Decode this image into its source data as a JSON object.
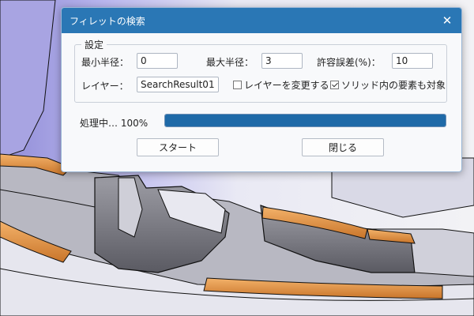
{
  "dialog": {
    "title": "フィレットの検索",
    "close_glyph": "✕",
    "group_label": "設定",
    "min_radius": {
      "label": "最小半径：",
      "value": "0"
    },
    "max_radius": {
      "label": "最大半径：",
      "value": "3"
    },
    "tolerance": {
      "label": "許容誤差(%)：",
      "value": "10"
    },
    "layer": {
      "label": "レイヤー：",
      "value": "SearchResult01"
    },
    "change_layer_checkbox": {
      "label": "レイヤーを変更する",
      "checked": false
    },
    "solid_elements_checkbox": {
      "label": "ソリッド内の要素も対象",
      "checked": true
    },
    "progress": {
      "label": "処理中… 100%",
      "value": 1.0
    },
    "start_button": "スタート",
    "close_button": "閉じる"
  },
  "colors": {
    "titlebar": "#2a77b5",
    "progress_fill": "#1f6aa8",
    "fillet_highlight": "#e0923c"
  }
}
